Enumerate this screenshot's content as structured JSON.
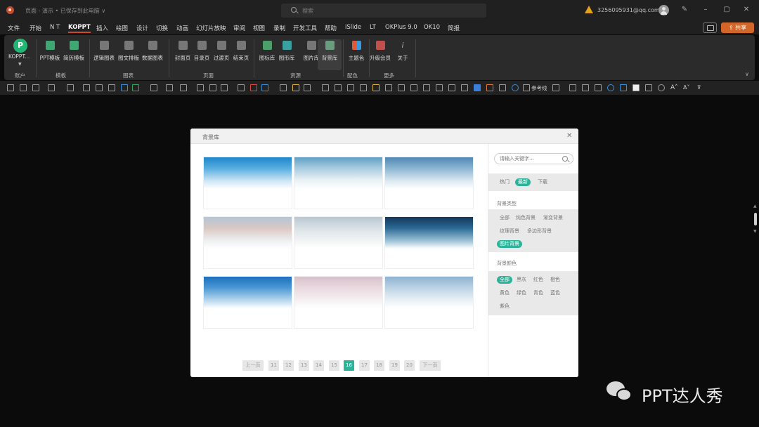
{
  "titlebar": {
    "doc_title": "页面 - 演示 • 已保存到此电脑 ∨",
    "search_placeholder": "搜索",
    "account": "3256095931@qq.com",
    "window_buttons": [
      "pen-icon",
      "minimize-icon",
      "restore-icon",
      "close-icon"
    ]
  },
  "tabs": [
    "文件",
    "开始",
    "N T",
    "KOPPT",
    "插入",
    "绘图",
    "设计",
    "切换",
    "动画",
    "幻灯片放映",
    "审阅",
    "视图",
    "录制",
    "开发工具",
    "帮助",
    "iSlide",
    "LT",
    "OKPlus 9.0",
    "OK10",
    "简报"
  ],
  "active_tab": "KOPPT",
  "share_label": "共享",
  "ribbon": {
    "account_btn": "KOPPT...",
    "groups": [
      {
        "label": "账户"
      },
      {
        "label": "模板",
        "buttons": [
          "PPT模板",
          "简历模板"
        ]
      },
      {
        "label": "图表",
        "buttons": [
          "逻辑图表",
          "图文排版",
          "数据图表"
        ]
      },
      {
        "label": "页面",
        "buttons": [
          "封面页",
          "目录页",
          "过渡页",
          "结束页"
        ]
      },
      {
        "label": "资源",
        "buttons": [
          "图标库",
          "图形库",
          "图片库",
          "背景库"
        ]
      },
      {
        "label": "配色",
        "buttons": [
          "主题色"
        ]
      },
      {
        "label": "更多",
        "buttons": [
          "升级会员",
          "关于"
        ]
      }
    ],
    "selected_button": "背景库"
  },
  "toolbar2": {
    "ref_line_label": "参考线"
  },
  "dialog": {
    "title": "背景库",
    "thumbnails": [
      {
        "name": "sky-bg-1"
      },
      {
        "name": "sky-bg-2"
      },
      {
        "name": "sky-bg-3"
      },
      {
        "name": "sky-bg-4"
      },
      {
        "name": "sky-bg-5"
      },
      {
        "name": "sky-bg-6"
      },
      {
        "name": "sky-bg-7"
      },
      {
        "name": "sky-bg-8"
      },
      {
        "name": "sky-bg-9"
      }
    ],
    "pagination": {
      "prev": "上一页",
      "pages": [
        "11",
        "12",
        "13",
        "14",
        "15",
        "16",
        "17",
        "18",
        "19",
        "20"
      ],
      "current": "16",
      "next": "下一页"
    },
    "sidebar": {
      "search_placeholder": "请输入关键字...",
      "sort": [
        "热门",
        "最新",
        "下载"
      ],
      "sort_active": "最新",
      "type_heading": "背景类型",
      "types": [
        "全部",
        "纯色背景",
        "渐变背景",
        "纹理背景",
        "多边形背景",
        "图片背景"
      ],
      "type_active": "图片背景",
      "color_heading": "背景颜色",
      "colors": [
        "全部",
        "黑灰",
        "红色",
        "橙色",
        "黄色",
        "绿色",
        "青色",
        "蓝色",
        "紫色"
      ],
      "color_active": "全部"
    }
  },
  "watermark": {
    "text": "PPT达人秀"
  },
  "colors": {
    "accent": "#2db39a",
    "share": "#d2662a",
    "brand": "#c94a2a"
  }
}
